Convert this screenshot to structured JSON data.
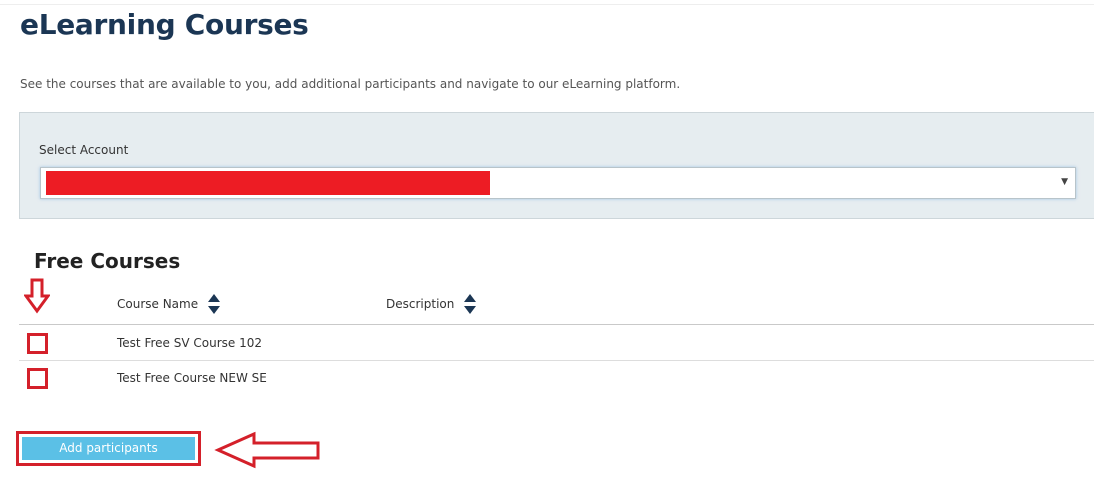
{
  "page": {
    "title": "eLearning Courses",
    "intro": "See the courses that are available to you, add additional participants and navigate to our eLearning platform."
  },
  "account": {
    "label": "Select Account",
    "selected_value": ""
  },
  "free_courses": {
    "title": "Free Courses",
    "columns": [
      "Course Name",
      "Description"
    ],
    "rows": [
      {
        "name": "Test Free SV Course 102",
        "description": ""
      },
      {
        "name": "Test Free Course NEW SE",
        "description": ""
      }
    ]
  },
  "actions": {
    "add_participants_label": "Add participants"
  },
  "colors": {
    "title": "#1b3654",
    "panel_bg": "#e6edf0",
    "button_bg": "#5bc0e6",
    "annotation_red": "#d4202a",
    "redaction": "#ed1c24"
  }
}
